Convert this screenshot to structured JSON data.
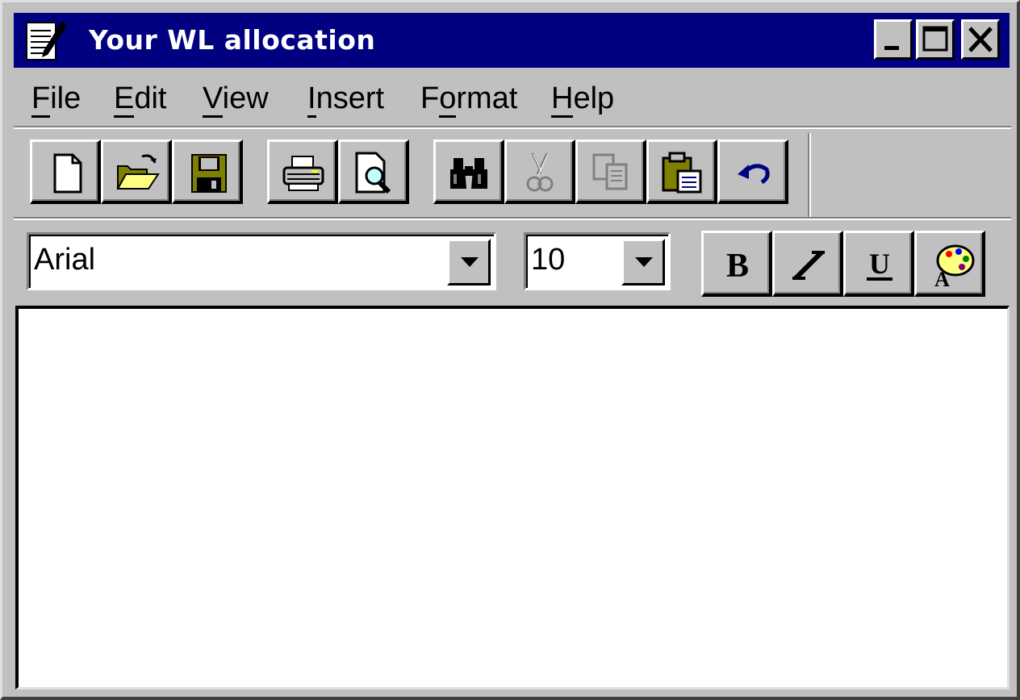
{
  "window": {
    "title": "Your WL allocation",
    "app_icon": "notepad-pen-icon",
    "controls": [
      "minimize-icon",
      "maximize-icon",
      "close-icon"
    ]
  },
  "menu": {
    "items": [
      {
        "label": "File",
        "accel": "F"
      },
      {
        "label": "Edit",
        "accel": "E"
      },
      {
        "label": "View",
        "accel": "V"
      },
      {
        "label": "Insert",
        "accel": "I"
      },
      {
        "label": "Format",
        "accel": "o"
      },
      {
        "label": "Help",
        "accel": "H"
      }
    ]
  },
  "toolbar": {
    "buttons": [
      {
        "icon": "new-document-icon",
        "enabled": true
      },
      {
        "icon": "open-folder-icon",
        "enabled": true
      },
      {
        "icon": "save-disk-icon",
        "enabled": true
      },
      {
        "icon": "print-icon",
        "enabled": true
      },
      {
        "icon": "print-preview-icon",
        "enabled": true
      },
      {
        "icon": "find-binoculars-icon",
        "enabled": true
      },
      {
        "icon": "cut-scissors-icon",
        "enabled": false
      },
      {
        "icon": "copy-icon",
        "enabled": false
      },
      {
        "icon": "paste-icon",
        "enabled": true
      },
      {
        "icon": "undo-icon",
        "enabled": true
      }
    ]
  },
  "format_bar": {
    "font_name": "Arial",
    "font_size": "10",
    "bold_icon": "bold-icon",
    "italic_icon": "italic-icon",
    "underline_icon": "underline-icon",
    "color_icon": "color-palette-icon"
  },
  "document": {
    "text": ""
  },
  "colors": {
    "titlebar": "#000080",
    "face": "#c0c0c0",
    "document": "#ffffff"
  }
}
